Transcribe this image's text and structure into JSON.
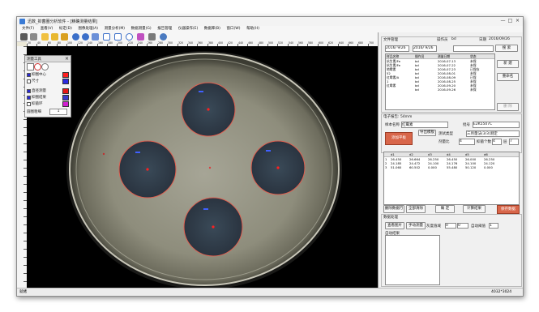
{
  "window": {
    "title": "迅数_抑菌圈分析软件 - [精确测量结果]",
    "controls": [
      "—",
      "□",
      "×"
    ]
  },
  "menu": [
    {
      "id": "file",
      "label": "文件(F)"
    },
    {
      "id": "view",
      "label": "查看(V)"
    },
    {
      "id": "calibrate",
      "label": "标定(D)"
    },
    {
      "id": "image",
      "label": "图像处理(A)"
    },
    {
      "id": "measure",
      "label": "测量分析(M)"
    },
    {
      "id": "result",
      "label": "数据测量(G)"
    },
    {
      "id": "report",
      "label": "报告管理"
    },
    {
      "id": "device",
      "label": "仪器操作(E)"
    },
    {
      "id": "data",
      "label": "数据库(B)"
    },
    {
      "id": "window",
      "label": "窗口(W)"
    },
    {
      "id": "help",
      "label": "帮助(H)"
    }
  ],
  "toolbar_icons": [
    "save-icon",
    "scissor-icon",
    "open-folder-icon",
    "folder-icon",
    "image-icon",
    "zoom-in-icon",
    "zoom-out-icon",
    "fit-window-icon",
    "select-icon",
    "move-icon",
    "ring-icon",
    "stamp-icon",
    "report-icon",
    "settings-icon"
  ],
  "ruler_labels": [
    "20",
    "40",
    "60",
    "80",
    "100",
    "120",
    "140",
    "160",
    "180",
    "200",
    "220",
    "240",
    "260",
    "280",
    "300",
    "320",
    "340",
    "360",
    "380",
    "400",
    "420",
    "440",
    "460",
    "480",
    "500",
    "520",
    "540",
    "560",
    "580",
    "600",
    "620",
    "640",
    "660",
    "680",
    "700"
  ],
  "tool_palette": {
    "title": "测量工具",
    "close": "×",
    "options": [
      {
        "label": "抑圈中心",
        "checked": true,
        "color": "#ff2020"
      },
      {
        "label": "尺寸",
        "checked": false,
        "color": "#2a2ae0"
      },
      {
        "label": "直径测量",
        "checked": true,
        "color": "#e81818"
      },
      {
        "label": "抑圈结果",
        "checked": true,
        "color": "#3a3acc"
      },
      {
        "label": "抑菌环",
        "checked": false,
        "color": "#d020d0"
      }
    ],
    "size_label": "圆圈粗细",
    "size_value": "1"
  },
  "records": {
    "section_label": "文件管理",
    "operator_label": "操作员",
    "operator_value": "bd",
    "date_label": "日期",
    "date_value": "2016/09/26",
    "from_date": "2016/ 9/26",
    "to_date": "2016/ 9/26",
    "search_button": "搜 索",
    "columns": [
      "样品名称",
      "操作员",
      "测量日期",
      "状态"
    ],
    "rows": [
      [
        "抗生素/Fe",
        "bd",
        "2016-07-13",
        "未保"
      ],
      [
        "抗生素/Fe",
        "bd",
        "2016-07-22",
        "未保"
      ],
      [
        "地霉素",
        "bd",
        "2016-07-23",
        "已保存"
      ],
      [
        "52",
        "bd",
        "2016-08-01",
        "未保"
      ],
      [
        "红霉素/A",
        "bd",
        "2016-08-09",
        "已保"
      ],
      [
        "1",
        "bd",
        "2016-08-25",
        "未保"
      ],
      [
        "红霉素",
        "bd",
        "2016-09-20",
        "未保"
      ],
      [
        "",
        "bd",
        "2016-09-26",
        "未保"
      ]
    ],
    "buttons": [
      "新 建",
      "重命名",
      "删除"
    ],
    "delete_button": "删 除"
  },
  "sample": {
    "section_label": "电子报告: 54mm",
    "name_label": "样本名称",
    "name_value": "红霉素",
    "id_label": "批号",
    "id_value": "E2K5507C",
    "template_button": "导出模板",
    "dilution_label": "测试类型",
    "dilution_value": "三剂量法(3/3)测定",
    "import_button": "添加平板",
    "dose_label": "剂量比",
    "dose_value": "4",
    "count_label": "抑菌个数",
    "count_value": "4",
    "ring_label": "层",
    "ring_value": "7"
  },
  "results": {
    "columns": [
      "",
      "d1",
      "d2",
      "d3",
      "d4",
      "d5",
      "d6"
    ],
    "rows": [
      [
        "1",
        "26.450",
        "26.664",
        "26.250",
        "26.450",
        "26.000",
        "26.250"
      ],
      [
        "2",
        "24.185",
        "24.472",
        "24.100",
        "24.176",
        "24.100",
        "24.120"
      ],
      [
        "3",
        "51.060",
        "60.502",
        "0.000",
        "55.480",
        "50.120",
        "0.000"
      ]
    ],
    "buttons": {
      "delete_row": "删除数据行",
      "clear_all": "全部清除",
      "ok": "确 定",
      "calc": "计算结果",
      "save": "保存数据"
    }
  },
  "measure": {
    "section_label": "数据处理",
    "show_image_button": "查看图片",
    "manual_button": "手动测量",
    "limit_label": "灰度值域",
    "limit_from": "0",
    "limit_to": "0",
    "threshold_label": "自动阈值",
    "threshold_value": "1",
    "notes_label": "自动结果"
  },
  "status": {
    "left": "就绪",
    "right": "4032*3024"
  },
  "zones": [
    {
      "id": "top"
    },
    {
      "id": "left"
    },
    {
      "id": "right"
    },
    {
      "id": "bottom"
    }
  ]
}
